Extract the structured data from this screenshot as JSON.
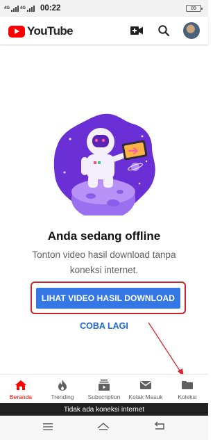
{
  "status_bar": {
    "network_1": "4G",
    "network_2": "4G",
    "time": "00:22",
    "battery": "89"
  },
  "app_bar": {
    "logo_text": "YouTube",
    "icons": [
      "video-camera-add-icon",
      "search-icon",
      "avatar"
    ]
  },
  "offline": {
    "title": "Anda sedang offline",
    "subtitle": "Tonton video hasil download tanpa koneksi internet.",
    "primary_button": "LIHAT VIDEO HASIL DOWNLOAD",
    "retry_button": "COBA LAGI"
  },
  "bottom_nav": {
    "items": [
      {
        "label": "Beranda",
        "icon": "home-icon",
        "active": true
      },
      {
        "label": "Trending",
        "icon": "flame-icon",
        "active": false
      },
      {
        "label": "Subscription",
        "icon": "subscriptions-icon",
        "active": false
      },
      {
        "label": "Kotak Masuk",
        "icon": "mail-icon",
        "active": false
      },
      {
        "label": "Koleksi",
        "icon": "folder-icon",
        "active": false
      }
    ]
  },
  "offline_banner": "Tidak ada koneksi internet",
  "system_nav": [
    "menu-icon",
    "home-nav-icon",
    "back-icon"
  ],
  "colors": {
    "brand_red": "#ff0000",
    "button_blue": "#3578e5",
    "link_blue": "#1a67d2",
    "highlight_red": "#c4262e",
    "illustration_purple": "#6b2fd6"
  }
}
